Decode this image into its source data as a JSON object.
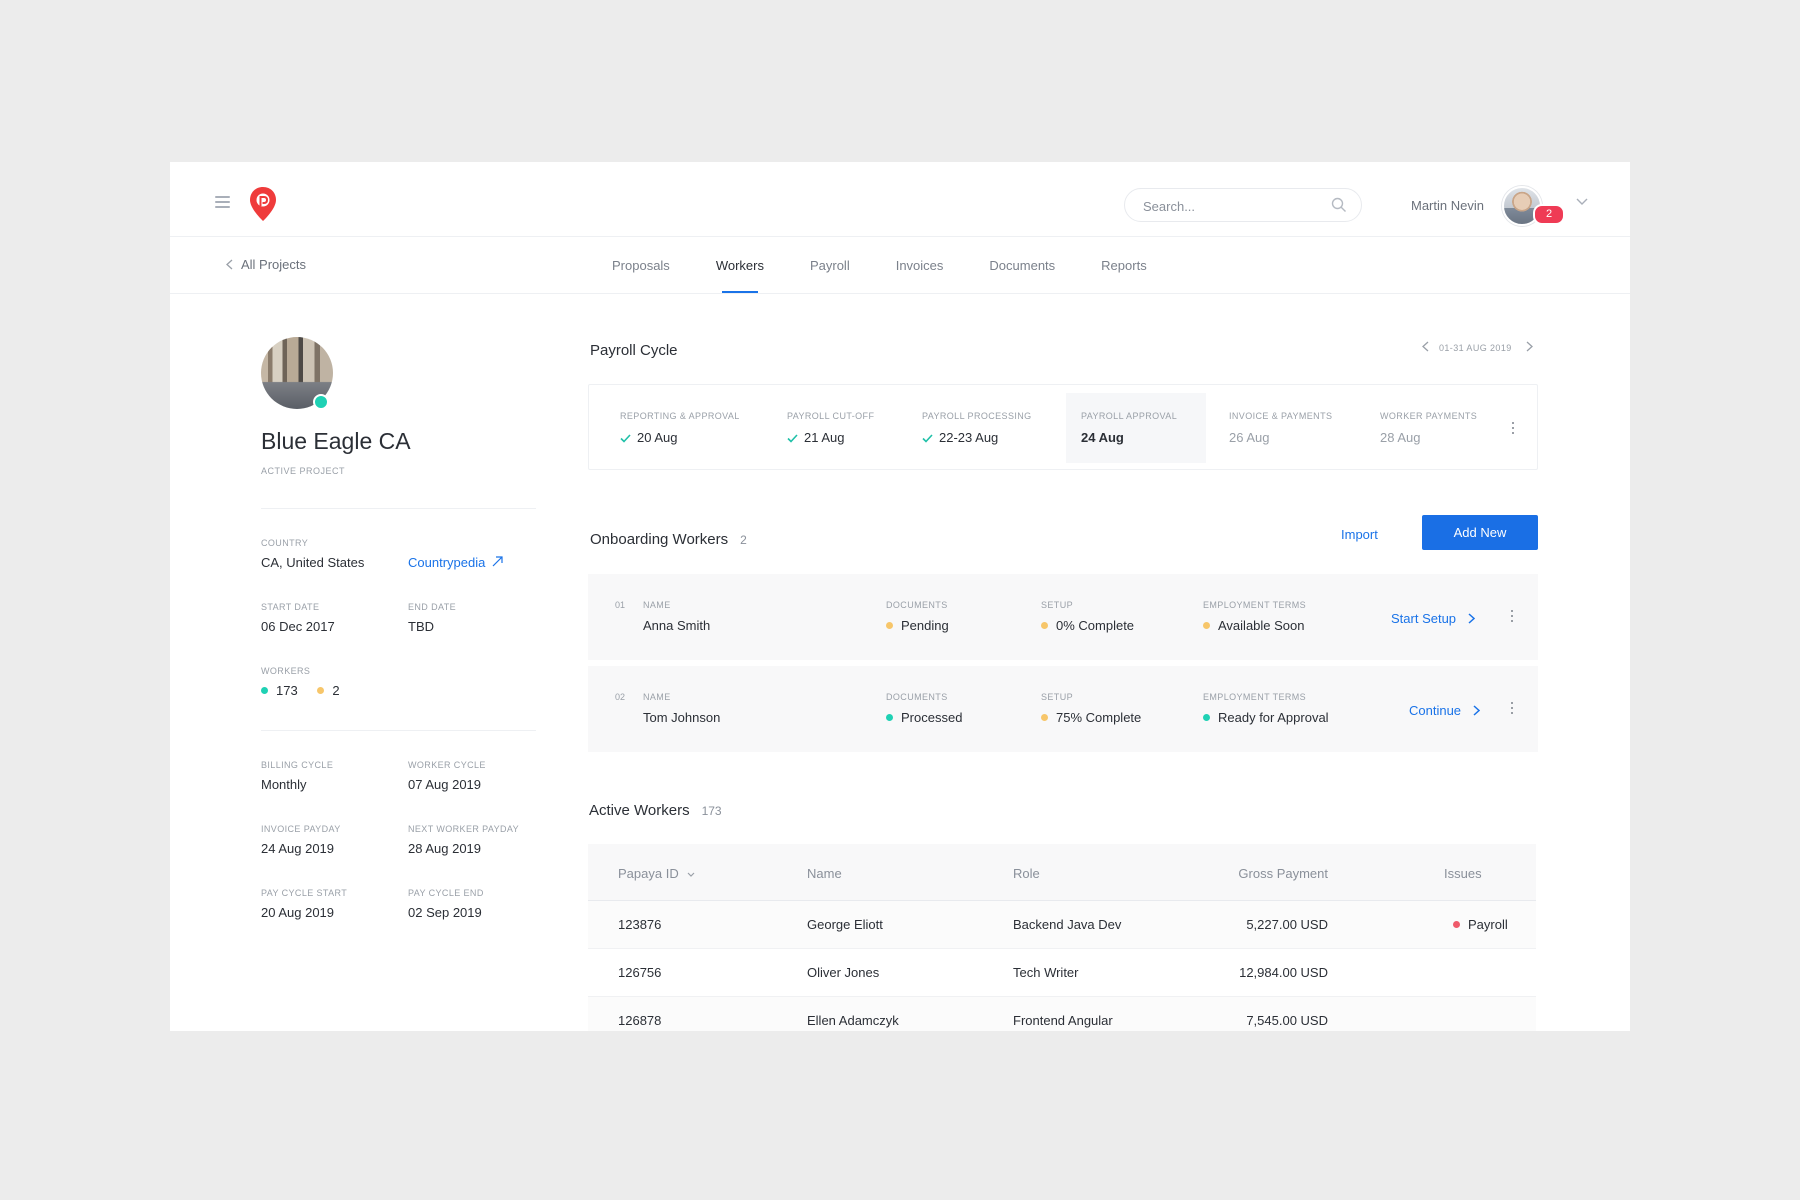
{
  "header": {
    "search_placeholder": "Search...",
    "user_name": "Martin Nevin",
    "notification_count": "2"
  },
  "subnav": {
    "back_label": "All Projects",
    "tabs": [
      "Proposals",
      "Workers",
      "Payroll",
      "Invoices",
      "Documents",
      "Reports"
    ],
    "active_tab": "Workers"
  },
  "project": {
    "title": "Blue Eagle CA",
    "status": "ACTIVE PROJECT",
    "country_label": "COUNTRY",
    "country_value": "CA, United States",
    "countrypedia_link": "Countrypedia",
    "start_date_label": "START DATE",
    "start_date_value": "06 Dec 2017",
    "end_date_label": "END DATE",
    "end_date_value": "TBD",
    "workers_label": "WORKERS",
    "workers_active": "173",
    "workers_onboarding": "2",
    "billing_cycle_label": "BILLING CYCLE",
    "billing_cycle_value": "Monthly",
    "worker_cycle_label": "WORKER CYCLE",
    "worker_cycle_value": "07 Aug 2019",
    "invoice_payday_label": "INVOICE PAYDAY",
    "invoice_payday_value": "24 Aug 2019",
    "next_worker_payday_label": "NEXT WORKER PAYDAY",
    "next_worker_payday_value": "28 Aug 2019",
    "pay_cycle_start_label": "PAY CYCLE START",
    "pay_cycle_start_value": "20 Aug 2019",
    "pay_cycle_end_label": "PAY CYCLE END",
    "pay_cycle_end_value": "02 Sep 2019"
  },
  "payroll_cycle": {
    "title": "Payroll Cycle",
    "range": "01-31 AUG 2019",
    "steps": [
      {
        "label": "REPORTING & APPROVAL",
        "value": "20 Aug",
        "state": "done"
      },
      {
        "label": "PAYROLL CUT-OFF",
        "value": "21 Aug",
        "state": "done"
      },
      {
        "label": "PAYROLL PROCESSING",
        "value": "22-23 Aug",
        "state": "done"
      },
      {
        "label": "PAYROLL APPROVAL",
        "value": "24 Aug",
        "state": "current"
      },
      {
        "label": "INVOICE & PAYMENTS",
        "value": "26 Aug",
        "state": "future"
      },
      {
        "label": "WORKER PAYMENTS",
        "value": "28 Aug",
        "state": "future"
      }
    ]
  },
  "onboarding": {
    "title": "Onboarding Workers",
    "count": "2",
    "import_label": "Import",
    "add_new_label": "Add New",
    "col_labels": {
      "name": "NAME",
      "documents": "DOCUMENTS",
      "setup": "SETUP",
      "terms": "EMPLOYMENT TERMS"
    },
    "rows": [
      {
        "num": "01",
        "name": "Anna Smith",
        "documents": "Pending",
        "setup": "0% Complete",
        "terms": "Available Soon",
        "action": "Start Setup"
      },
      {
        "num": "02",
        "name": "Tom Johnson",
        "documents": "Processed",
        "setup": "75% Complete",
        "terms": "Ready for Approval",
        "action": "Continue"
      }
    ]
  },
  "active_workers": {
    "title": "Active Workers",
    "count": "173",
    "columns": [
      "Papaya ID",
      "Name",
      "Role",
      "Gross Payment",
      "Issues"
    ],
    "rows": [
      {
        "id": "123876",
        "name": "George Eliott",
        "role": "Backend Java Dev",
        "gross": "5,227.00 USD",
        "issues": "Payroll"
      },
      {
        "id": "126756",
        "name": "Oliver Jones",
        "role": "Tech Writer",
        "gross": "12,984.00 USD",
        "issues": ""
      },
      {
        "id": "126878",
        "name": "Ellen Adamczyk",
        "role": "Frontend Angular",
        "gross": "7,545.00 USD",
        "issues": ""
      }
    ]
  },
  "colors": {
    "accent": "#1a73e8",
    "status_teal": "#1fd1b4",
    "status_amber": "#f7c66a",
    "status_red": "#ef5b6b",
    "badge": "#ef3b55"
  }
}
